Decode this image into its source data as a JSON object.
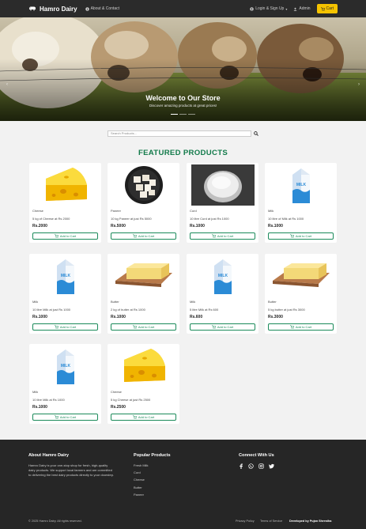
{
  "nav": {
    "brand": "Hamro Dairy",
    "about": "About & Contact",
    "login": "Login & Sign Up",
    "admin": "Admin",
    "cart": "Cart"
  },
  "hero": {
    "title": "Welcome to Our Store",
    "subtitle": "Discover amazing products at great prices!"
  },
  "search": {
    "placeholder": "Search Products..."
  },
  "featured": {
    "title": "FEATURED PRODUCTS"
  },
  "products": [
    {
      "category": "Cheese",
      "desc": "5 kg of Cheese at Rs 2000",
      "price": "Rs.2000",
      "image": "cheese-image",
      "button": "Add to Cart"
    },
    {
      "category": "Paneer",
      "desc": "10 kg Paneer at just Rs 5000",
      "price": "Rs.5000",
      "image": "paneer-image",
      "button": "Add to Cart"
    },
    {
      "category": "Curd",
      "desc": "10 litre Curd at just Rs 1000",
      "price": "Rs.1000",
      "image": "curd-image",
      "button": "Add to Cart"
    },
    {
      "category": "Milk",
      "desc": "10 litre of Milk at Rs 1000",
      "price": "Rs.1000",
      "image": "milk-image",
      "button": "Add to Cart"
    },
    {
      "category": "Milk",
      "desc": "10 litre Milk at just Rs 1000",
      "price": "Rs.1000",
      "image": "milk-image",
      "button": "Add to Cart"
    },
    {
      "category": "Butter",
      "desc": "2 kg of butter at Rs 1000",
      "price": "Rs.1000",
      "image": "butter-image",
      "button": "Add to Cart"
    },
    {
      "category": "Milk",
      "desc": "5 litre Milk at Rs 600",
      "price": "Rs.600",
      "image": "milk-image",
      "button": "Add to Cart"
    },
    {
      "category": "Butter",
      "desc": "5 kg butter at just Rs 3000",
      "price": "Rs.3000",
      "image": "butter-image",
      "button": "Add to Cart"
    },
    {
      "category": "Milk",
      "desc": "10 litre Milk at Rs 1000",
      "price": "Rs.1000",
      "image": "milk-image",
      "button": "Add to Cart"
    },
    {
      "category": "Cheese",
      "desc": "5 kg Cheese at just Rs 2500",
      "price": "Rs.2500",
      "image": "cheese-image",
      "button": "Add to Cart"
    }
  ],
  "footer": {
    "about_title": "About Hamro Dairy",
    "about_text": "Hamro Dairy is your one-stop shop for fresh, high-quality dairy products. We support local farmers and are committed to delivering the best dairy products directly to your doorstep.",
    "popular_title": "Popular Products",
    "popular": [
      "Fresh Milk",
      "Curd",
      "Cheese",
      "Butter",
      "Paneer"
    ],
    "connect_title": "Connect With Us",
    "copyright": "© 2025 Hamro Dairy. All rights reserved.",
    "privacy": "Privacy Policy",
    "terms": "Terms of Service",
    "developer": "Developed by Pujan Shrestha"
  }
}
